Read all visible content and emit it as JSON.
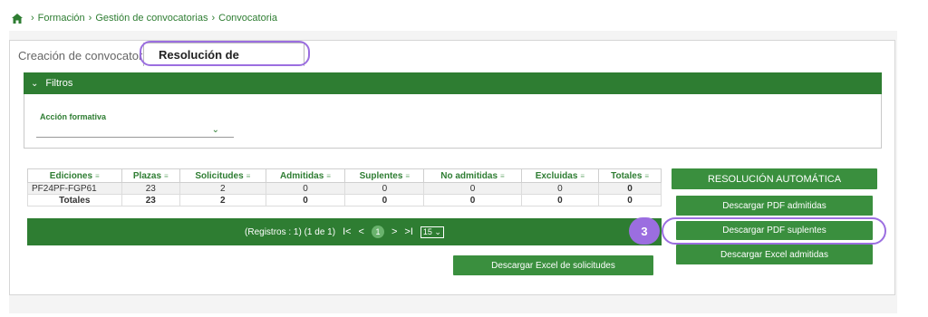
{
  "breadcrumb": {
    "items": [
      "Formación",
      "Gestión de convocatorias",
      "Convocatoria"
    ],
    "separator": "›"
  },
  "tabs": {
    "creacion": "Creación de convocatoria",
    "resolucion": "Resolución de convocatoria"
  },
  "filters": {
    "title": "Filtros",
    "accion_formativa_label": "Acción formativa",
    "accion_formativa_value": ""
  },
  "table": {
    "headers": [
      "Ediciones",
      "Plazas",
      "Solicitudes",
      "Admitidas",
      "Suplentes",
      "No admitidas",
      "Excluidas",
      "Totales"
    ],
    "rows": [
      [
        "PF24PF-FGP61",
        "23",
        "2",
        "0",
        "0",
        "0",
        "0",
        "0"
      ]
    ],
    "totals": [
      "Totales",
      "23",
      "2",
      "0",
      "0",
      "0",
      "0",
      "0"
    ]
  },
  "pager": {
    "summary": "(Registros : 1) (1 de 1)",
    "first": "I<",
    "prev": "<",
    "current_page": "1",
    "next": ">",
    "last": ">I",
    "per_page": "15"
  },
  "buttons": {
    "resolucion_automatica": "RESOLUCIÓN AUTOMÁTICA",
    "descargar_pdf_admitidas": "Descargar PDF admitidas",
    "descargar_pdf_suplentes": "Descargar PDF suplentes",
    "descargar_excel_admitidas": "Descargar Excel admitidas",
    "descargar_excel_solicitudes": "Descargar Excel de solicitudes"
  },
  "annotation": {
    "step": "3"
  },
  "colors": {
    "primary_green": "#2e7d32",
    "highlight_purple": "#9b6ee0"
  }
}
